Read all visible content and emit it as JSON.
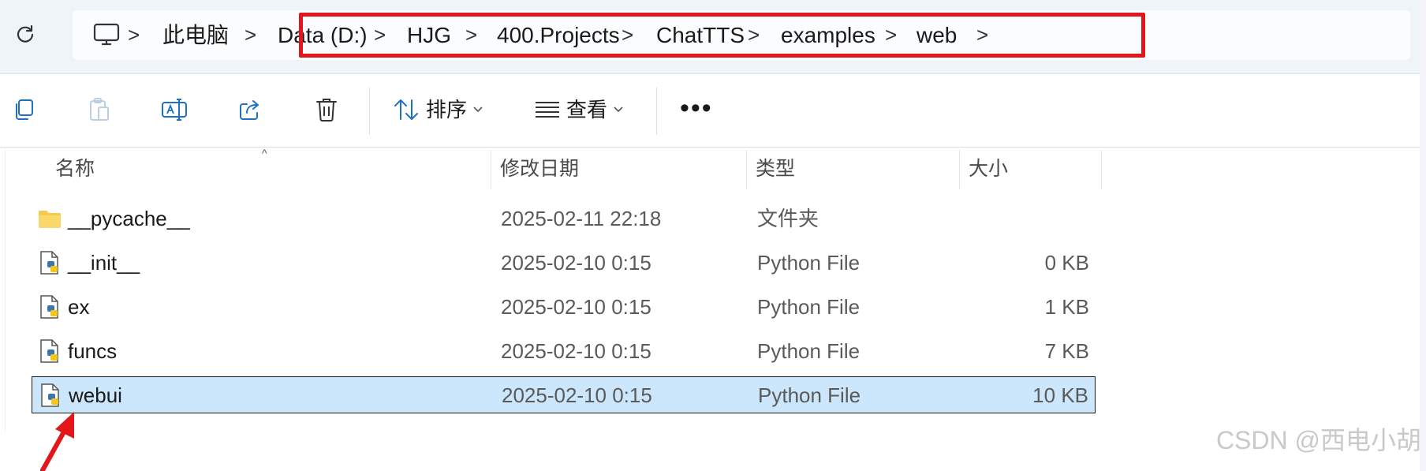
{
  "address_bar": {
    "pc_label": "此电脑",
    "path": [
      "Data (D:)",
      "HJG",
      "400.Projects",
      "ChatTTS",
      "examples",
      "web"
    ],
    "separator": ">"
  },
  "toolbar": {
    "sort_label": "排序",
    "view_label": "查看",
    "more_label": "•••"
  },
  "columns": {
    "name": "名称",
    "date": "修改日期",
    "type": "类型",
    "size": "大小"
  },
  "files": [
    {
      "name": "__pycache__",
      "date": "2025-02-11 22:18",
      "type": "文件夹",
      "size": "",
      "icon": "folder-icon"
    },
    {
      "name": "__init__",
      "date": "2025-02-10 0:15",
      "type": "Python File",
      "size": "0 KB",
      "icon": "python-file-icon"
    },
    {
      "name": "ex",
      "date": "2025-02-10 0:15",
      "type": "Python File",
      "size": "1 KB",
      "icon": "python-file-icon"
    },
    {
      "name": "funcs",
      "date": "2025-02-10 0:15",
      "type": "Python File",
      "size": "7 KB",
      "icon": "python-file-icon"
    },
    {
      "name": "webui",
      "date": "2025-02-10 0:15",
      "type": "Python File",
      "size": "10 KB",
      "icon": "python-file-icon",
      "selected": true
    }
  ],
  "watermark": "CSDN @西电小胡",
  "colors": {
    "highlight_box": "#e3161b",
    "selected_row": "#cce6fb",
    "arrow": "#e3161b",
    "folder": "#f8c94a"
  }
}
